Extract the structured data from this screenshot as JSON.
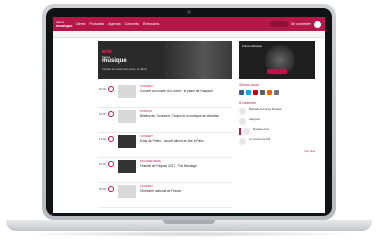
{
  "site": {
    "logo_line1": "france",
    "logo_line2": "musique",
    "nav": [
      "Direct",
      "Podcasts",
      "Agenda",
      "Concerts",
      "Émissions"
    ],
    "top_right": [
      "Se connecter"
    ]
  },
  "hero": {
    "brand": "arte",
    "brand_sub": "france",
    "brand_main": "musique",
    "caption": "Concert au musée du Louvre, en direct"
  },
  "list": [
    {
      "time": "20:00",
      "cat": "CONCERT",
      "title": "Concert au musée du Louvre : le piano de Gaspard"
    },
    {
      "time": "16:00",
      "cat": "PODCAST",
      "title": "Beethoven, Schubert, Chopin et la musique de chambre"
    },
    {
      "time": "13:00",
      "cat": "CONCERT",
      "title": "Eddy de Pretto : nouvel album en live à Paris"
    },
    {
      "time": "10:00",
      "cat": "DOCUMENTAIRE",
      "title": "Festival de Pâques 2017 : The Bandage"
    },
    {
      "time": "09:00",
      "cat": "CONCERT",
      "title": "Orchestre national de France"
    }
  ],
  "sidebar": {
    "radio_label": "France Musique",
    "radio_button": "ÉCOUTER",
    "follow_title": "Suivez-nous",
    "section_title": "À l'antenne",
    "items": [
      "Matinale de France Musique",
      "Allegretto",
      "Musique émoi",
      "Le Concert de 20h"
    ],
    "more": "Voir plus"
  },
  "colors": {
    "accent": "#b5174b",
    "dark": "#1e1e1e"
  }
}
